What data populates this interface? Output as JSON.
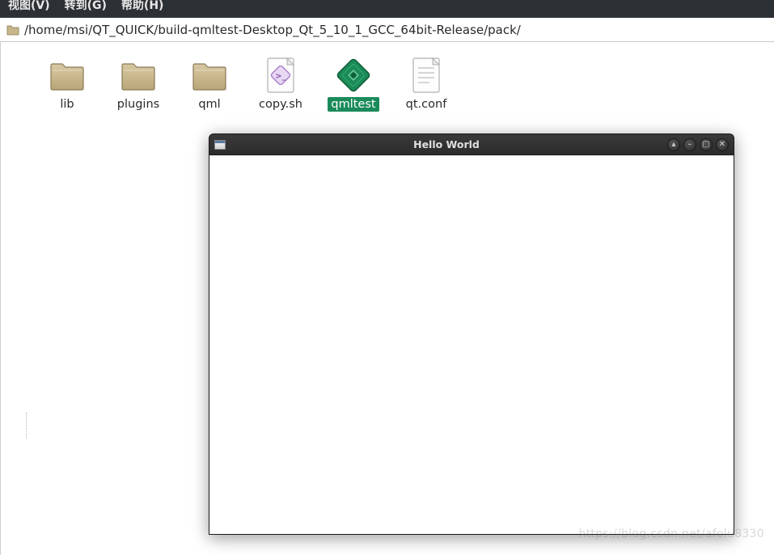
{
  "menu": {
    "view": "视图(V)",
    "goto": "转到(G)",
    "help": "帮助(H)"
  },
  "path": "/home/msi/QT_QUICK/build-qmltest-Desktop_Qt_5_10_1_GCC_64bit-Release/pack/",
  "files": [
    {
      "name": "lib",
      "type": "folder",
      "selected": false
    },
    {
      "name": "plugins",
      "type": "folder",
      "selected": false
    },
    {
      "name": "qml",
      "type": "folder",
      "selected": false
    },
    {
      "name": "copy.sh",
      "type": "script",
      "selected": false
    },
    {
      "name": "qmltest",
      "type": "exec",
      "selected": true
    },
    {
      "name": "qt.conf",
      "type": "text",
      "selected": false
    }
  ],
  "appwin": {
    "title": "Hello World"
  },
  "watermark": "https://blog.csdn.net/afolu8330"
}
